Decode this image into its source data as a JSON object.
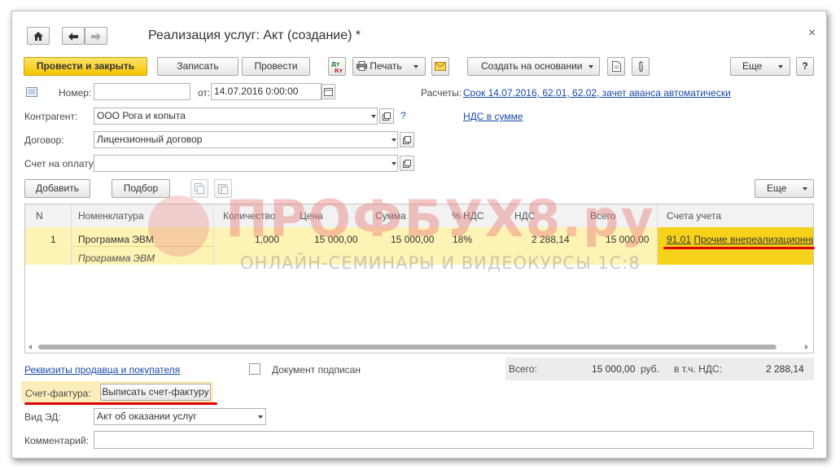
{
  "window": {
    "title": "Реализация услуг: Акт (создание) *",
    "close_label": "×"
  },
  "toolbar": {
    "post_close_label": "Провести и закрыть",
    "save_label": "Записать",
    "post_label": "Провести",
    "print_label": "Печать",
    "create_based_label": "Создать на основании",
    "more_label": "Еще",
    "help_label": "?"
  },
  "header": {
    "number_label": "Номер:",
    "number_value": "",
    "date_label": "от:",
    "date_value": "14.07.2016  0:00:00",
    "settlements_label": "Расчеты:",
    "settlements_link": "Срок 14.07.2016, 62.01, 62.02, зачет аванса автоматически",
    "vat_link": "НДС в сумме",
    "counterparty_label": "Контрагент:",
    "counterparty_value": "ООО Рога и копыта",
    "counterparty_help": "?",
    "contract_label": "Договор:",
    "contract_value": "Лицензионный договор",
    "invoice_label": "Счет на оплату:",
    "invoice_value": ""
  },
  "table_toolbar": {
    "add_label": "Добавить",
    "pick_label": "Подбор",
    "more_label": "Еще"
  },
  "table": {
    "columns": [
      "N",
      "Номенклатура",
      "Количество",
      "Цена",
      "Сумма",
      "% НДС",
      "НДС",
      "Всего",
      "Счета учета"
    ],
    "rows": [
      {
        "n": "1",
        "nomenclature": "Программа ЭВМ",
        "content": "Программа ЭВМ",
        "quantity": "1,000",
        "price": "15 000,00",
        "sum": "15 000,00",
        "vat_rate": "18%",
        "vat": "2 288,14",
        "total": "15 000,00",
        "account_code": "91.01",
        "account_name": "Прочие внереализационные"
      }
    ]
  },
  "footer": {
    "requisites_link": "Реквизиты продавца и покупателя",
    "signed_label": "Документ подписан",
    "total_label": "Всего:",
    "total_value": "15 000,00",
    "currency": "руб.",
    "vat_incl_label": "в т.ч. НДС:",
    "vat_incl_value": "2 288,14",
    "invoice_label": "Счет-фактура:",
    "issue_invoice_label": "Выписать счет-фактуру",
    "ed_type_label": "Вид ЭД:",
    "ed_type_value": "Акт об оказании услуг",
    "comment_label": "Комментарий:",
    "comment_value": ""
  },
  "watermark": {
    "main": "ПРОФБУХ8.ру",
    "sub": "ОНЛАЙН-СЕМИНАРЫ И ВИДЕОКУРСЫ 1С:8"
  },
  "colors": {
    "accent_yellow": "#f5c400",
    "row_highlight": "#fdf3b4",
    "link_blue": "#1a4aa8",
    "annotation_red": "#e00000"
  }
}
